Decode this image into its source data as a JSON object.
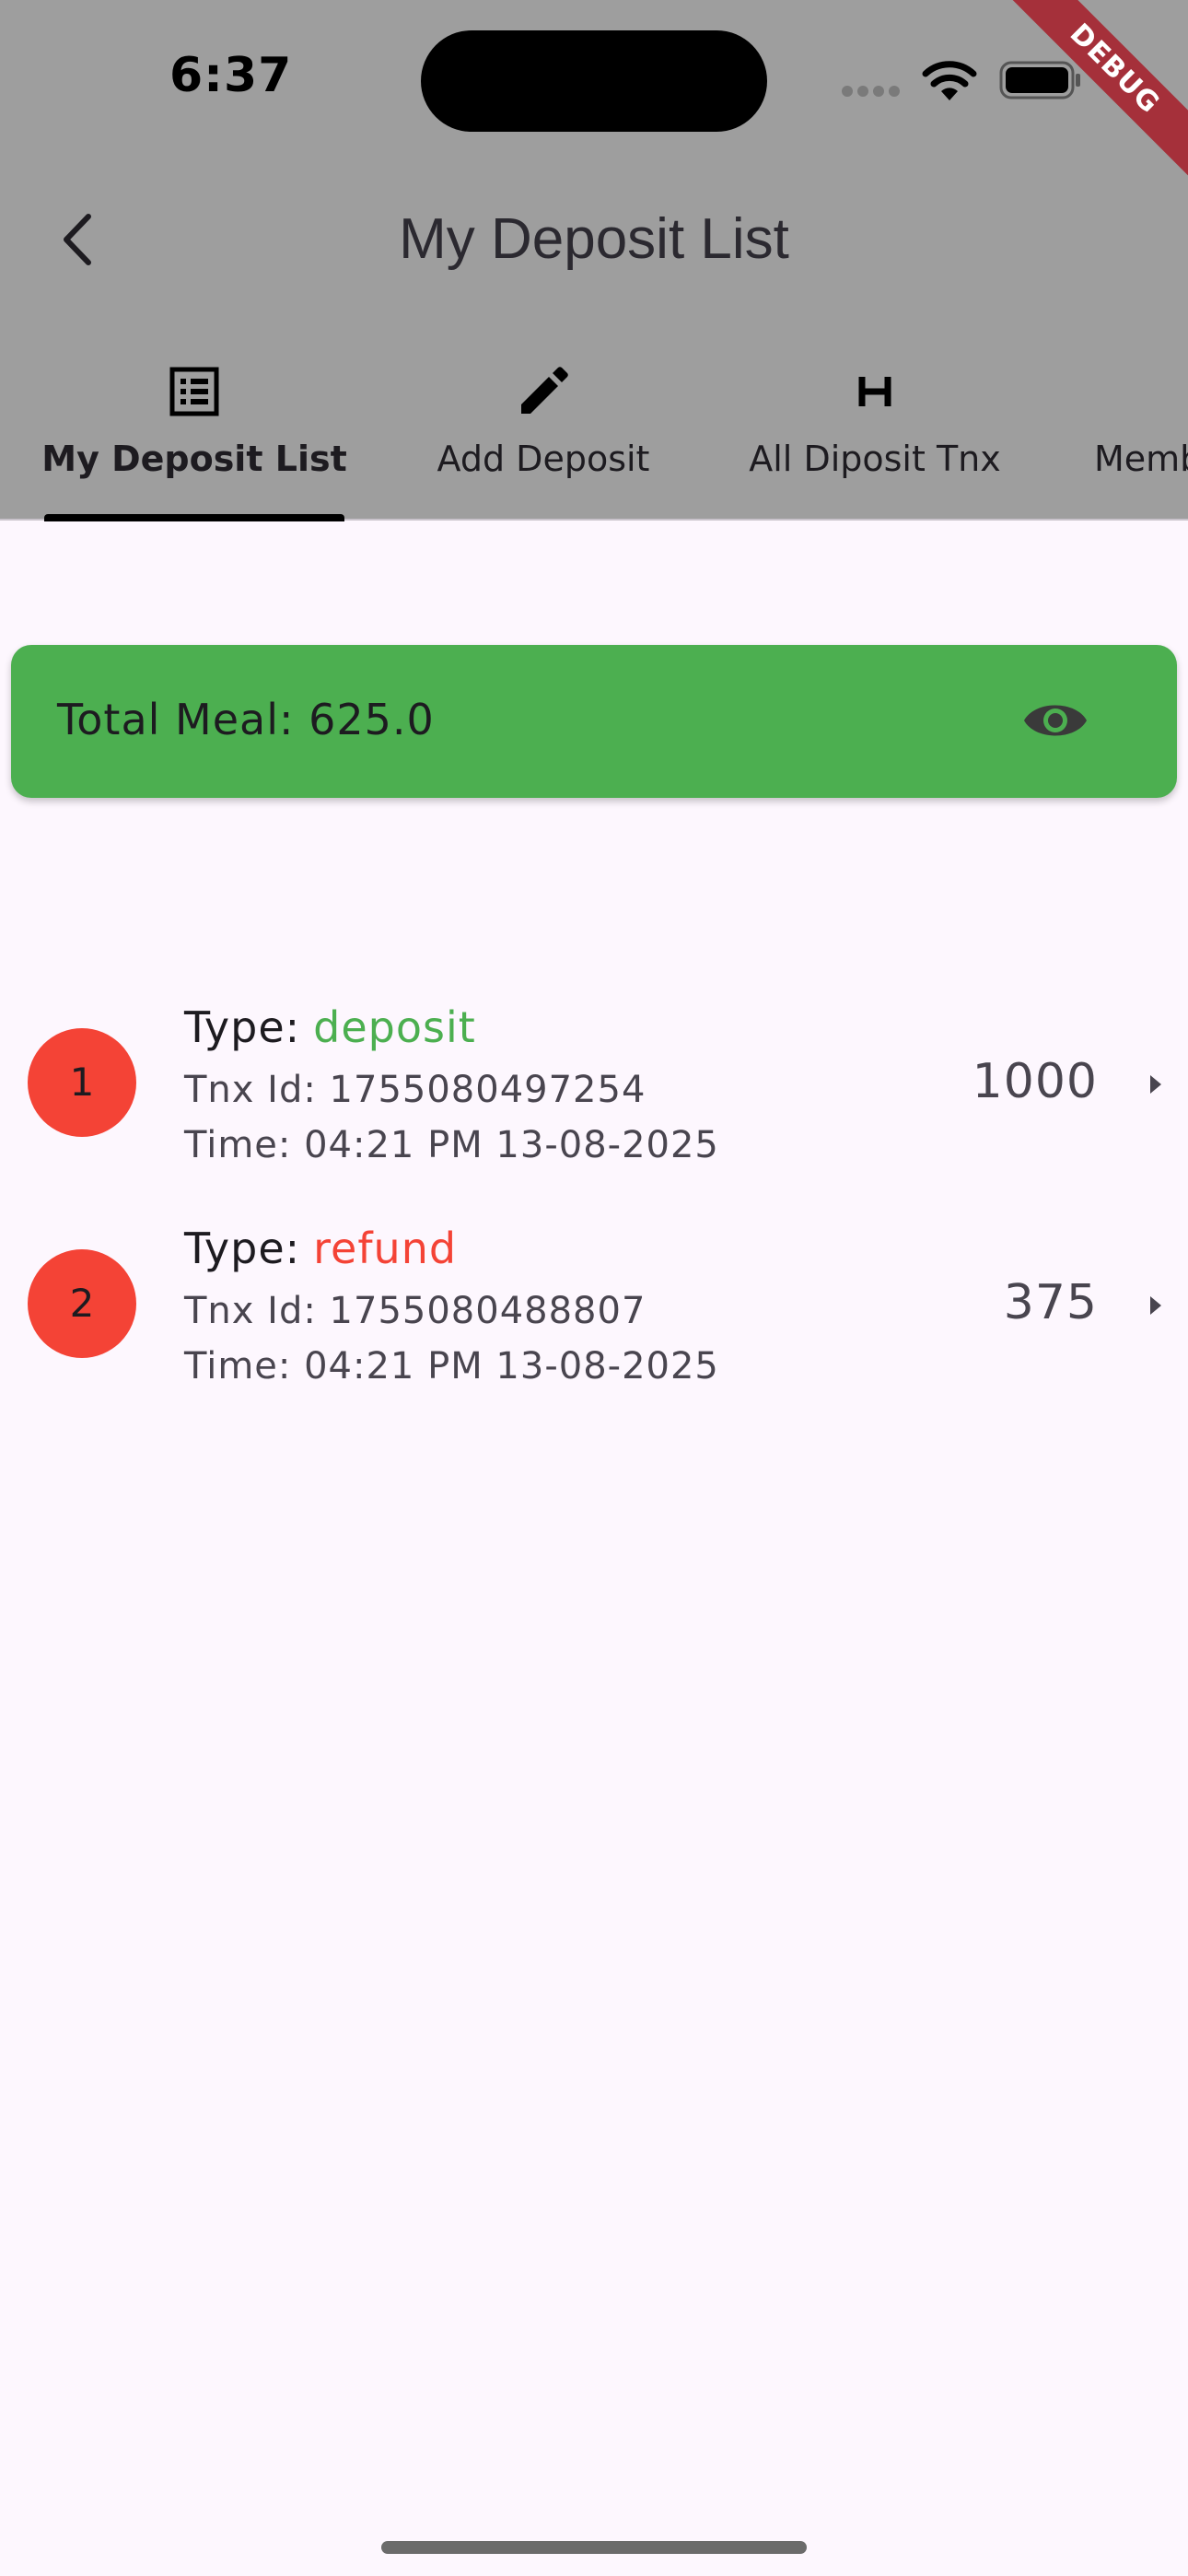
{
  "status_bar": {
    "time": "6:37"
  },
  "debug_banner": {
    "label": "DEBUG"
  },
  "appbar": {
    "title": "My Deposit List"
  },
  "tabs": [
    {
      "label": "My Deposit List",
      "icon": "list-alt-icon",
      "active": true
    },
    {
      "label": "Add Deposit",
      "icon": "pencil-icon",
      "active": false
    },
    {
      "label": "All Diposit Tnx",
      "icon": "h-letter-icon",
      "active": false
    },
    {
      "label": "Memb",
      "icon": "",
      "active": false
    }
  ],
  "summary": {
    "label": "Total Meal: 625.0",
    "icon": "eye-icon"
  },
  "transactions": [
    {
      "index": "1",
      "type_label": "Type:",
      "type_value": "deposit",
      "type_color": "#4caf50",
      "tnx_id": "Tnx Id: 1755080497254",
      "time": "Time: 04:21 PM 13-08-2025",
      "amount": "1000"
    },
    {
      "index": "2",
      "type_label": "Type:",
      "type_value": "refund",
      "type_color": "#f44336",
      "tnx_id": "Tnx Id: 1755080488807",
      "time": "Time: 04:21 PM 13-08-2025",
      "amount": "375"
    }
  ],
  "colors": {
    "header_bg": "#9e9e9e",
    "card_green": "#4caf50",
    "avatar_red": "#f44336",
    "page_bg": "#fdf7fe"
  }
}
